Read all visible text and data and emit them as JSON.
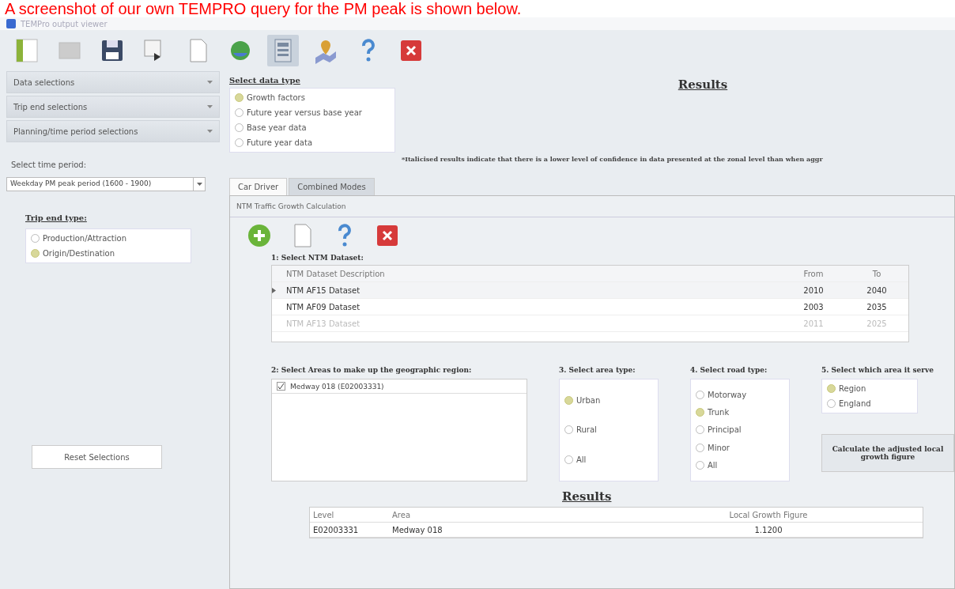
{
  "caption": "A screenshot of our own TEMPRO query for the PM peak is shown below.",
  "window": {
    "title": "TEMPro output viewer"
  },
  "toolbar": [
    {
      "kind": "panel"
    },
    {
      "kind": "grid"
    },
    {
      "kind": "save"
    },
    {
      "kind": "export"
    },
    {
      "kind": "page"
    },
    {
      "kind": "refresh"
    },
    {
      "kind": "calc",
      "selected": true
    },
    {
      "kind": "map"
    },
    {
      "kind": "help"
    },
    {
      "kind": "close"
    }
  ],
  "sidebar": {
    "sections": [
      "Data selections",
      "Trip end selections",
      "Planning/time period selections"
    ],
    "time_label": "Select time period:",
    "time_value": "Weekday PM peak period (1600 - 1900)",
    "trip_end": {
      "title": "Trip end type:",
      "options": [
        {
          "label": "Production/Attraction",
          "selected": false
        },
        {
          "label": "Origin/Destination",
          "selected": true
        }
      ]
    },
    "reset": "Reset Selections"
  },
  "data_type": {
    "title": "Select data type",
    "options": [
      {
        "label": "Growth factors",
        "selected": true
      },
      {
        "label": "Future year versus base year",
        "selected": false
      },
      {
        "label": "Base year data",
        "selected": false
      },
      {
        "label": "Future year data",
        "selected": false
      }
    ]
  },
  "results_title": "Results",
  "note": "*Italicised results indicate that there is a lower level of confidence in data presented at the zonal level than when aggr",
  "tabs": [
    {
      "label": "Car Driver",
      "selected": true
    },
    {
      "label": "Combined Modes",
      "selected": false
    }
  ],
  "panel": {
    "title": "NTM Traffic Growth Calculation",
    "tools": [
      {
        "kind": "add"
      },
      {
        "kind": "copy"
      },
      {
        "kind": "help"
      },
      {
        "kind": "close"
      }
    ],
    "dataset": {
      "title": "1: Select NTM Dataset:",
      "columns": [
        "NTM Dataset Description",
        "From",
        "To"
      ],
      "rows": [
        {
          "cells": [
            "NTM AF15 Dataset",
            "2010",
            "2040"
          ],
          "selected": true,
          "disabled": false
        },
        {
          "cells": [
            "NTM AF09 Dataset",
            "2003",
            "2035"
          ],
          "selected": false,
          "disabled": false
        },
        {
          "cells": [
            "NTM AF13 Dataset",
            "2011",
            "2025"
          ],
          "selected": false,
          "disabled": true
        }
      ]
    },
    "areas": {
      "title": "2: Select Areas to make up the geographic region:",
      "items": [
        {
          "label": "Medway 018 (E02003331)",
          "checked": true
        }
      ]
    },
    "area_type": {
      "title": "3. Select area type:",
      "options": [
        {
          "label": "Urban",
          "selected": true
        },
        {
          "label": "Rural",
          "selected": false
        },
        {
          "label": "All",
          "selected": false
        }
      ]
    },
    "road_type": {
      "title": "4. Select road type:",
      "options": [
        {
          "label": "Motorway",
          "selected": false
        },
        {
          "label": "Trunk",
          "selected": true
        },
        {
          "label": "Principal",
          "selected": false
        },
        {
          "label": "Minor",
          "selected": false
        },
        {
          "label": "All",
          "selected": false
        }
      ]
    },
    "serves": {
      "title": "5. Select which area it serve",
      "options": [
        {
          "label": "Region",
          "selected": true
        },
        {
          "label": "England",
          "selected": false
        }
      ]
    },
    "calculate": "Calculate the adjusted local growth figure",
    "results_title": "Results",
    "results": {
      "columns": [
        "Level",
        "Area",
        "Local Growth Figure"
      ],
      "rows": [
        [
          "E02003331",
          "Medway 018",
          "1.1200"
        ]
      ]
    }
  }
}
